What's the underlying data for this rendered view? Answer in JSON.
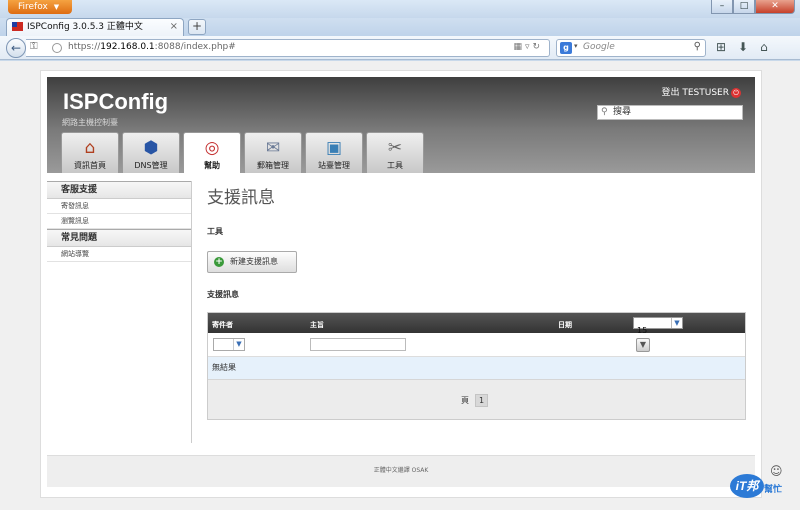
{
  "browser": {
    "menu_button": "Firefox",
    "tab_title": "ISPConfig 3.0.5.3 正體中文",
    "url_prefix": "https://",
    "url_host": "192.168.0.1",
    "url_rest": ":8088/index.php#",
    "search_placeholder": "Google",
    "search_engine_icon": "g-icon"
  },
  "app": {
    "logo": "ISPConfig",
    "subtitle": "網路主機控制臺",
    "logout": "登出 TESTUSER",
    "search_value": "搜尋",
    "tabs": [
      {
        "label": "資訊首頁",
        "icon": "home-icon"
      },
      {
        "label": "DNS管理",
        "icon": "dns-icon"
      },
      {
        "label": "幫助",
        "icon": "lifebuoy-icon"
      },
      {
        "label": "郵箱管理",
        "icon": "mail-icon"
      },
      {
        "label": "站臺管理",
        "icon": "site-icon"
      },
      {
        "label": "工具",
        "icon": "tools-icon"
      }
    ],
    "active_tab": "幫助"
  },
  "sidebar": {
    "sections": [
      {
        "title": "客服支援",
        "items": [
          "寄發訊息",
          "瀏覽訊息"
        ]
      },
      {
        "title": "常見問題",
        "items": [
          "網站導覽"
        ]
      }
    ]
  },
  "main": {
    "heading": "支援訊息",
    "tools_label": "工具",
    "new_button": "新建支援訊息",
    "list_label": "支援訊息",
    "table": {
      "columns": [
        "寄件者",
        "主旨",
        "日期"
      ],
      "per_page": "15",
      "empty_text": "無結果",
      "pager_label": "頁",
      "page": "1"
    }
  },
  "footer": {
    "text": "正體中文繼譯 OSAK"
  },
  "watermark": {
    "text": "幫忙",
    "logo": "iT邦"
  }
}
